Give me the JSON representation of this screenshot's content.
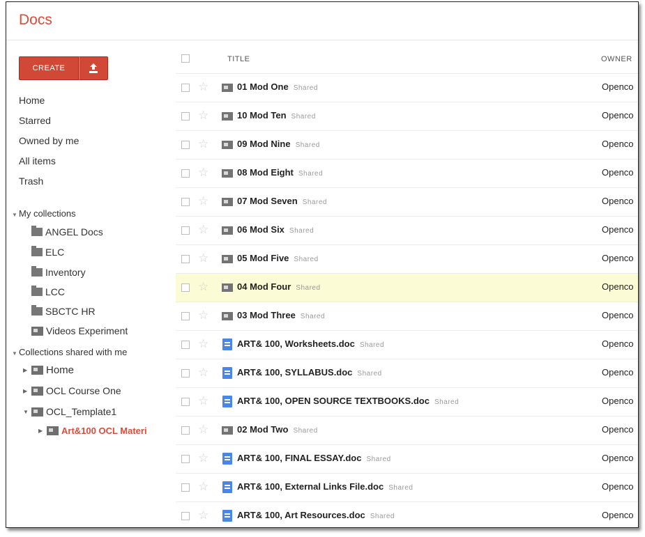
{
  "app": {
    "title": "Docs"
  },
  "toolbar": {
    "create_label": "CREATE",
    "upload_icon": "upload-icon"
  },
  "nav": {
    "items": [
      "Home",
      "Starred",
      "Owned by me",
      "All items",
      "Trash"
    ]
  },
  "my_collections": {
    "label": "My collections",
    "items": [
      "ANGEL Docs",
      "ELC",
      "Inventory",
      "LCC",
      "SBCTC HR",
      "Videos Experiment"
    ]
  },
  "shared_collections": {
    "label": "Collections shared with me",
    "items": [
      "Home",
      "OCL Course One",
      "OCL_Template1"
    ],
    "active": "Art&100 OCL Materi"
  },
  "table": {
    "headers": {
      "title": "TITLE",
      "owner": "OWNER"
    },
    "shared_tag": "Shared",
    "owner_value": "Openco",
    "rows": [
      {
        "title": "01 Mod One",
        "type": "folder"
      },
      {
        "title": "10 Mod Ten",
        "type": "folder"
      },
      {
        "title": "09 Mod Nine",
        "type": "folder"
      },
      {
        "title": "08 Mod Eight",
        "type": "folder"
      },
      {
        "title": "07 Mod Seven",
        "type": "folder"
      },
      {
        "title": "06 Mod Six",
        "type": "folder"
      },
      {
        "title": "05 Mod Five",
        "type": "folder"
      },
      {
        "title": "04 Mod Four",
        "type": "folder",
        "highlighted": true
      },
      {
        "title": "03 Mod Three",
        "type": "folder"
      },
      {
        "title": "ART& 100, Worksheets.doc",
        "type": "doc"
      },
      {
        "title": "ART& 100, SYLLABUS.doc",
        "type": "doc"
      },
      {
        "title": "ART& 100, OPEN SOURCE TEXTBOOKS.doc",
        "type": "doc"
      },
      {
        "title": "02 Mod Two",
        "type": "folder"
      },
      {
        "title": "ART& 100, FINAL ESSAY.doc",
        "type": "doc"
      },
      {
        "title": "ART& 100, External Links File.doc",
        "type": "doc"
      },
      {
        "title": "ART& 100, Art Resources.doc",
        "type": "doc"
      }
    ]
  },
  "colors": {
    "brand": "#dd4b39",
    "create_button": "#d14836",
    "highlight_row": "#fbfbd6",
    "doc_icon": "#4a86e8"
  }
}
